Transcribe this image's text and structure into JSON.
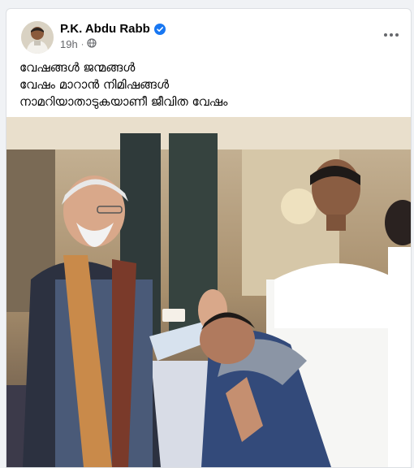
{
  "post": {
    "author": "P.K. Abdu Rabb",
    "verified_icon": "verified-badge-icon",
    "timestamp": "19h",
    "audience_icon": "globe-icon",
    "more_icon": "more-options-icon",
    "caption_lines": [
      "വേഷങ്ങൾ ജന്മങ്ങൾ",
      "വേഷം മാറാൻ നിമിഷങ്ങൾ",
      "നാമറിയാതാടുകയാണീ ജീവിത വേഷം"
    ]
  },
  "colors": {
    "verified_blue": "#1877f2",
    "meta_gray": "#65676b",
    "text_black": "#050505"
  }
}
